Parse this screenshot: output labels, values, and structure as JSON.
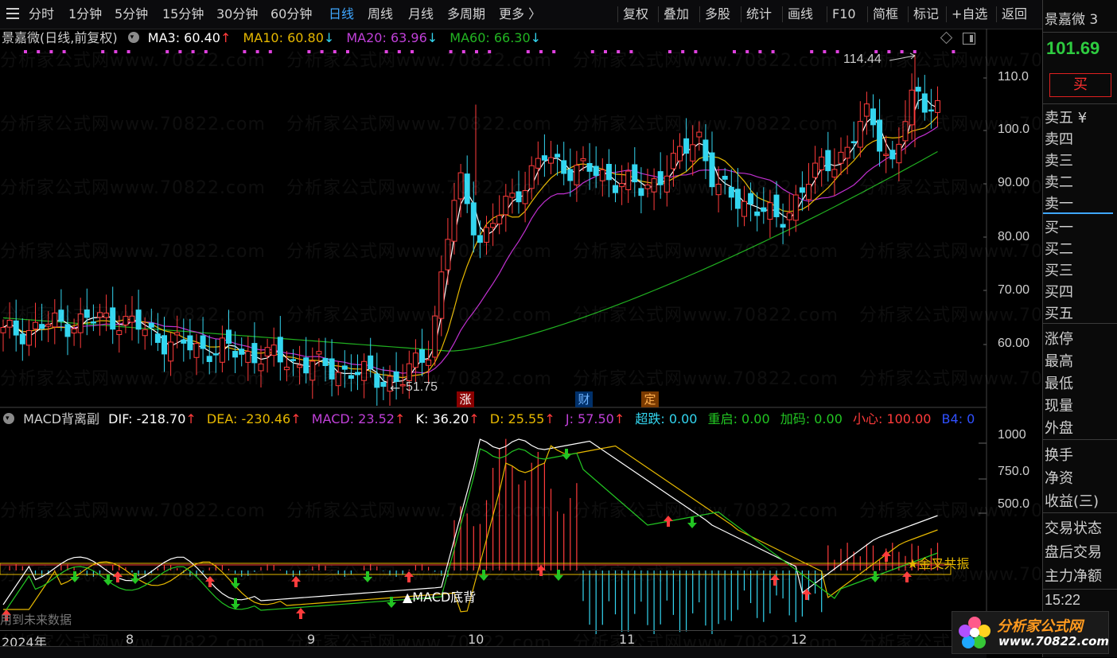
{
  "toolbar": {
    "periods": [
      "分时",
      "1分钟",
      "5分钟",
      "15分钟",
      "30分钟",
      "60分钟",
      "日线",
      "周线",
      "月线",
      "多周期",
      "更多 〉"
    ],
    "active_period": "日线",
    "tools": [
      "复权",
      "叠加",
      "多股",
      "统计",
      "画线",
      "F10",
      "简框",
      "标记",
      "+自选",
      "返回"
    ]
  },
  "main_legend": {
    "title": "景嘉微(日线,前复权)",
    "ma3": "MA3: 60.40",
    "ma10": "MA10: 60.80",
    "ma20": "MA20: 63.96",
    "ma60": "MA60: 66.30",
    "arrow_up": "↑",
    "arrow_down": "↓"
  },
  "sub_legend": {
    "title": "MACD背离副",
    "dif": "DIF: -218.70",
    "dea": "DEA: -230.46",
    "macd": "MACD: 23.52",
    "k": "K: 36.20",
    "d": "D: 25.55",
    "j": "J: 57.50",
    "chaodie": "超跌: 0.00",
    "chongqi": "重启: 0.00",
    "jiama": "加码: 0.00",
    "xiaoxin": "小心: 100.00",
    "b4": "B4: 0"
  },
  "price_axis": [
    "110.0",
    "100.0",
    "90.00",
    "80.00",
    "70.00",
    "60.00"
  ],
  "indicator_axis": [
    "1000",
    "750.0",
    "500.0"
  ],
  "x_axis": [
    "2024年",
    "8",
    "9",
    "10",
    "11",
    "12"
  ],
  "annotations": {
    "high": "114.44",
    "low": "51.75",
    "macd_div": "▲MACD底背",
    "golden_cross": "★金叉共振",
    "future_data": "用到未来数据",
    "tag_zhang": "涨",
    "tag_cai": "财",
    "tag_ding": "定"
  },
  "right_panel": {
    "stock_name": "景嘉微 3",
    "price": "101.69",
    "buy_button": "买",
    "sell_levels": [
      "卖五 ¥",
      "卖四",
      "卖三",
      "卖二",
      "卖一"
    ],
    "buy_levels": [
      "买一",
      "买二",
      "买三",
      "买四",
      "买五"
    ],
    "stats": [
      "涨停",
      "最高",
      "最低",
      "现量",
      "外盘"
    ],
    "stats2": [
      "换手",
      "净资",
      "收益(三)"
    ],
    "extra": [
      "交易状态",
      "盘后交易",
      "主力净额"
    ],
    "time": "15:22"
  },
  "watermark": "分析家公式网www.70822.com",
  "logo": {
    "title": "分析家公式网",
    "url": "www.70822.com"
  },
  "colors": {
    "up": "#ff3b3b",
    "down": "#33d6f0",
    "ma3": "#ffffff",
    "ma10": "#e6b800",
    "ma20": "#c030d0",
    "ma60": "#20b020",
    "active": "#3fa7ff"
  }
}
